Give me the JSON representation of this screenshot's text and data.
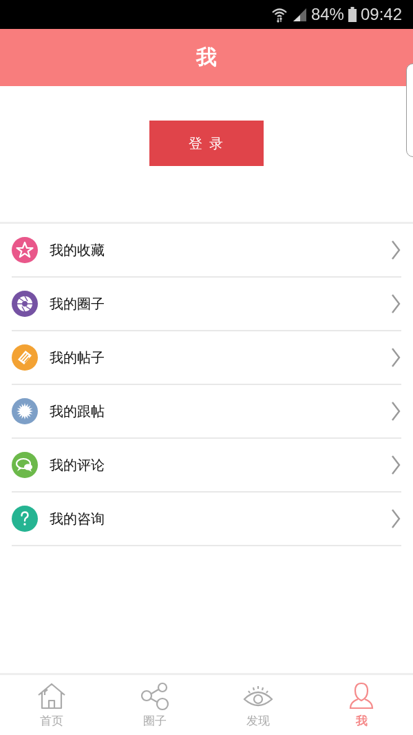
{
  "status_bar": {
    "battery": "84%",
    "time": "09:42"
  },
  "header": {
    "title": "我"
  },
  "login_button": {
    "label": "登 录"
  },
  "menu": [
    {
      "label": "我的收藏",
      "kind": "star",
      "color": "#e9578a"
    },
    {
      "label": "我的圈子",
      "kind": "aperture",
      "color": "#7552a3"
    },
    {
      "label": "我的帖子",
      "kind": "posts",
      "color": "#f3a233"
    },
    {
      "label": "我的跟帖",
      "kind": "burst",
      "color": "#7d9fc7"
    },
    {
      "label": "我的评论",
      "kind": "chat",
      "color": "#6cb94a"
    },
    {
      "label": "我的咨询",
      "kind": "question",
      "color": "#25b492"
    }
  ],
  "tabs": [
    {
      "label": "首页",
      "kind": "home",
      "selected": false
    },
    {
      "label": "圈子",
      "kind": "share",
      "selected": false
    },
    {
      "label": "发现",
      "kind": "eye",
      "selected": false
    },
    {
      "label": "我",
      "kind": "person",
      "selected": true
    }
  ]
}
